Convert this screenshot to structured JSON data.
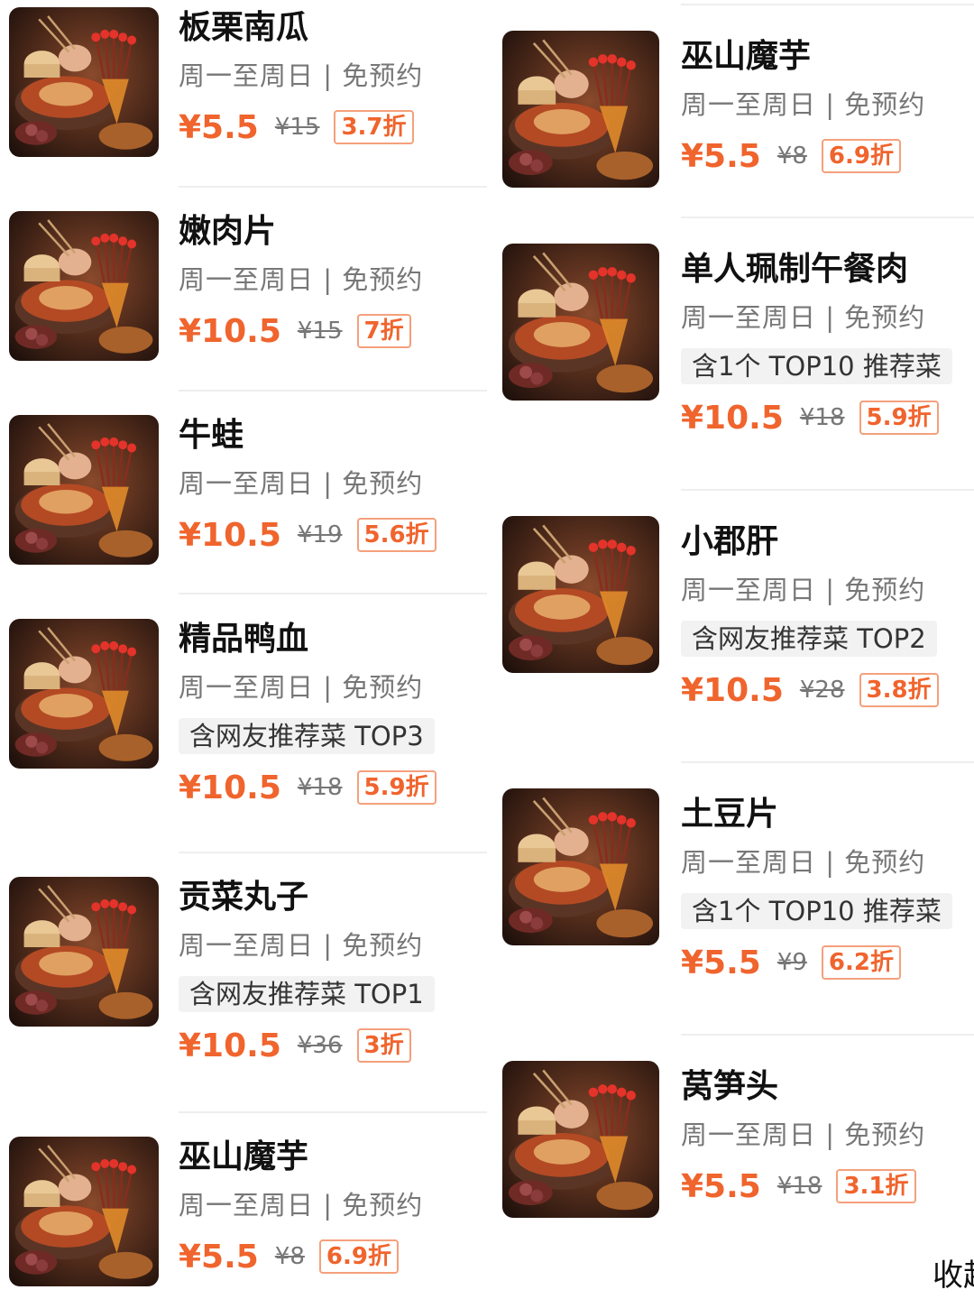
{
  "left_column": [
    {
      "name": "板栗南瓜",
      "sub": "周一至周日 | 免预约",
      "tag": "",
      "price": "¥5.5",
      "old_price": "¥15",
      "discount": "3.7折"
    },
    {
      "name": "嫩肉片",
      "sub": "周一至周日 | 免预约",
      "tag": "",
      "price": "¥10.5",
      "old_price": "¥15",
      "discount": "7折"
    },
    {
      "name": "牛蛙",
      "sub": "周一至周日 | 免预约",
      "tag": "",
      "price": "¥10.5",
      "old_price": "¥19",
      "discount": "5.6折"
    },
    {
      "name": "精品鸭血",
      "sub": "周一至周日 | 免预约",
      "tag": "含网友推荐菜 TOP3",
      "price": "¥10.5",
      "old_price": "¥18",
      "discount": "5.9折"
    },
    {
      "name": "贡菜丸子",
      "sub": "周一至周日 | 免预约",
      "tag": "含网友推荐菜 TOP1",
      "price": "¥10.5",
      "old_price": "¥36",
      "discount": "3折"
    },
    {
      "name": "巫山魔芋",
      "sub": "周一至周日 | 免预约",
      "tag": "",
      "price": "¥5.5",
      "old_price": "¥8",
      "discount": "6.9折"
    }
  ],
  "right_column": [
    {
      "name": "巫山魔芋",
      "sub": "周一至周日 | 免预约",
      "tag": "",
      "price": "¥5.5",
      "old_price": "¥8",
      "discount": "6.9折"
    },
    {
      "name": "单人珮制午餐肉",
      "sub": "周一至周日 | 免预约",
      "tag": "含1个 TOP10 推荐菜",
      "price": "¥10.5",
      "old_price": "¥18",
      "discount": "5.9折"
    },
    {
      "name": "小郡肝",
      "sub": "周一至周日 | 免预约",
      "tag": "含网友推荐菜 TOP2",
      "price": "¥10.5",
      "old_price": "¥28",
      "discount": "3.8折"
    },
    {
      "name": "土豆片",
      "sub": "周一至周日 | 免预约",
      "tag": "含1个 TOP10 推荐菜",
      "price": "¥5.5",
      "old_price": "¥9",
      "discount": "6.2折"
    },
    {
      "name": "莴笋头",
      "sub": "周一至周日 | 免预约",
      "tag": "",
      "price": "¥5.5",
      "old_price": "¥18",
      "discount": "3.1折"
    }
  ],
  "collapse_label": "收起",
  "colors": {
    "price": "#f0642d",
    "discount_border": "#f5a07c",
    "secondary_text": "#777777",
    "tag_bg": "#f2f2f2"
  },
  "icons": {
    "thumbnail": "hotpot-photo"
  }
}
